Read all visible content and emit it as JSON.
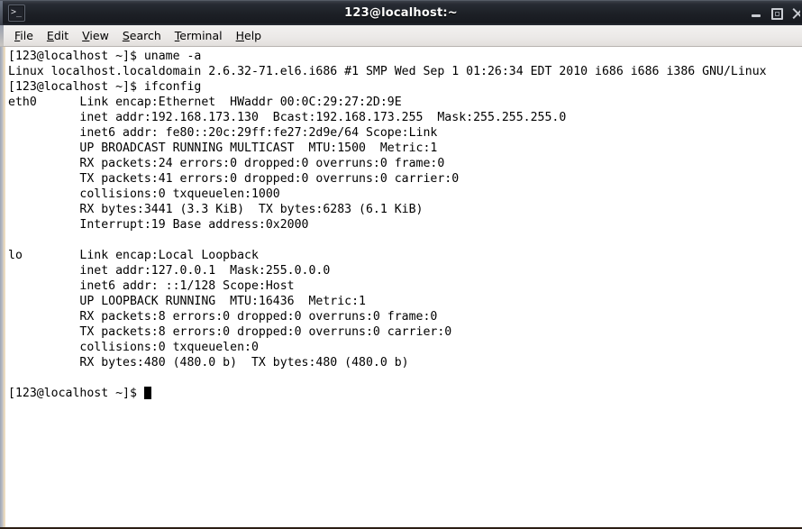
{
  "window": {
    "title": "123@localhost:~",
    "icon": "terminal-icon",
    "controls": {
      "minimize_label": "Minimize",
      "maximize_label": "Maximize",
      "close_label": "Close"
    }
  },
  "menubar": {
    "items": [
      {
        "label": "File",
        "mnemonic": "F"
      },
      {
        "label": "Edit",
        "mnemonic": "E"
      },
      {
        "label": "View",
        "mnemonic": "V"
      },
      {
        "label": "Search",
        "mnemonic": "S"
      },
      {
        "label": "Terminal",
        "mnemonic": "T"
      },
      {
        "label": "Help",
        "mnemonic": "H"
      }
    ]
  },
  "terminal": {
    "foreground_color": "#000000",
    "background_color": "#ffffff",
    "prompt": "[123@localhost ~]$",
    "cursor_visible": true,
    "lines": [
      "[123@localhost ~]$ uname -a",
      "Linux localhost.localdomain 2.6.32-71.el6.i686 #1 SMP Wed Sep 1 01:26:34 EDT 2010 i686 i686 i386 GNU/Linux",
      "[123@localhost ~]$ ifconfig",
      "eth0      Link encap:Ethernet  HWaddr 00:0C:29:27:2D:9E  ",
      "          inet addr:192.168.173.130  Bcast:192.168.173.255  Mask:255.255.255.0",
      "          inet6 addr: fe80::20c:29ff:fe27:2d9e/64 Scope:Link",
      "          UP BROADCAST RUNNING MULTICAST  MTU:1500  Metric:1",
      "          RX packets:24 errors:0 dropped:0 overruns:0 frame:0",
      "          TX packets:41 errors:0 dropped:0 overruns:0 carrier:0",
      "          collisions:0 txqueuelen:1000 ",
      "          RX bytes:3441 (3.3 KiB)  TX bytes:6283 (6.1 KiB)",
      "          Interrupt:19 Base address:0x2000 ",
      "",
      "lo        Link encap:Local Loopback  ",
      "          inet addr:127.0.0.1  Mask:255.0.0.0",
      "          inet6 addr: ::1/128 Scope:Host",
      "          UP LOOPBACK RUNNING  MTU:16436  Metric:1",
      "          RX packets:8 errors:0 dropped:0 overruns:0 frame:0",
      "          TX packets:8 errors:0 dropped:0 overruns:0 carrier:0",
      "          collisions:0 txqueuelen:0 ",
      "          RX bytes:480 (480.0 b)  TX bytes:480 (480.0 b)",
      ""
    ],
    "last_prompt": "[123@localhost ~]$ "
  }
}
